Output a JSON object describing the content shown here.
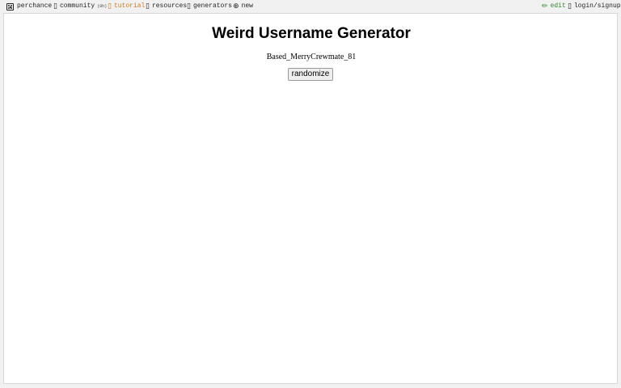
{
  "nav": {
    "perchance": "perchance",
    "community": "community",
    "community_badge": "(8h)",
    "tutorial": "tutorial",
    "resources": "resources",
    "generators": "generators",
    "new": "new",
    "edit": "edit",
    "login": "login/signup"
  },
  "icons": {
    "community": "chat-icon",
    "tutorial": "book-icon",
    "resources": "resources-icon",
    "generators": "generators-icon",
    "new": "plus-circle-icon",
    "edit": "pencil-icon",
    "login": "user-icon"
  },
  "colors": {
    "tutorial": "#d07a1a",
    "edit": "#2e8b2e"
  },
  "page": {
    "title": "Weird Username Generator",
    "result": "Based_MerryCrewmate_81",
    "button_label": "randomize"
  }
}
